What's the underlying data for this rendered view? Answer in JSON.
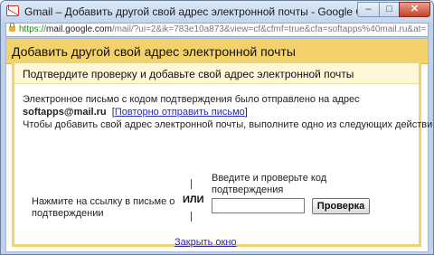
{
  "window": {
    "title": "Gmail – Добавить другой свой адрес электронной почты - Google Chrome",
    "minimize_glyph": "–",
    "maximize_glyph": "□",
    "close_glyph": "✕"
  },
  "address_bar": {
    "scheme": "https://",
    "domain": "mail.google.com",
    "path": "/mail/?ui=2&ik=783e10a873&view=cf&cfmf=true&cfa=softapps%40mail.ru&at="
  },
  "dialog": {
    "title": "Добавить другой свой адрес электронной почты",
    "subtitle": "Подтвердите проверку и добавьте свой адрес электронной почты",
    "sent_text": "Электронное письмо с кодом подтверждения было отправлено на адрес",
    "email": "softapps@mail.ru",
    "resend_link": "Повторно отправить письмо",
    "bracket_open": "[",
    "bracket_close": "]",
    "instruction": "Чтобы добавить свой адрес электронной почты, выполните одно из следующих действий:",
    "option_link_text": "Нажмите на ссылку в письме о подтверждении",
    "or_label": "ИЛИ",
    "option_code_text": "Введите и проверьте код подтверждения",
    "code_value": "",
    "verify_button": "Проверка",
    "close_link": "Закрыть окно"
  },
  "colors": {
    "header_bg": "#f4d26b",
    "subheader_bg": "#fff6d6",
    "link": "#2a2ab0",
    "https_green": "#1b8a1b"
  }
}
